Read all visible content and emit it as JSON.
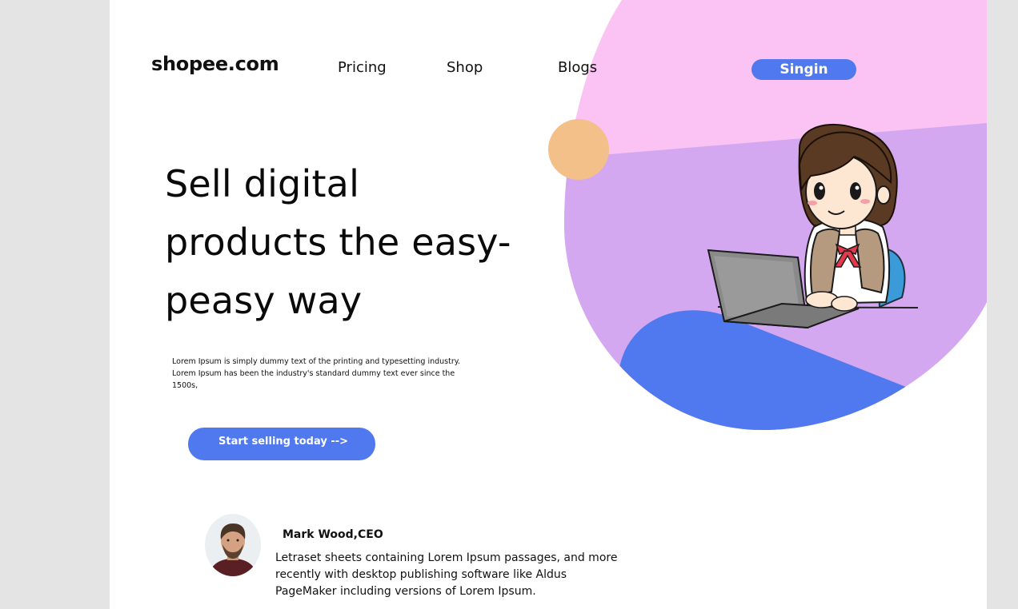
{
  "brand": {
    "logo_text": "shopee.com"
  },
  "nav": {
    "items": [
      {
        "label": "Pricing"
      },
      {
        "label": "Shop"
      },
      {
        "label": "Blogs"
      }
    ],
    "signin_label": "Singin"
  },
  "hero": {
    "headline": "Sell digital products the easy-peasy way",
    "description": "Lorem Ipsum is simply dummy text of the printing and typesetting industry. Lorem Ipsum has been the industry's standard dummy text ever since the 1500s,",
    "cta_label": "Start selling today  -->"
  },
  "testimonial": {
    "name": "Mark Wood,CEO",
    "quote": " Letraset sheets containing Lorem Ipsum passages, and more recently with desktop publishing software like Aldus PageMaker including versions of Lorem Ipsum."
  },
  "colors": {
    "accent": "#5079ef",
    "blob_pink": "#fac3f3",
    "blob_purple": "#d4a8f0",
    "circle_peach": "#f2c088",
    "page_bg": "#e4e4e4"
  },
  "icons": {
    "illustration": "woman-with-laptop-illustration",
    "avatar": "person-avatar"
  }
}
